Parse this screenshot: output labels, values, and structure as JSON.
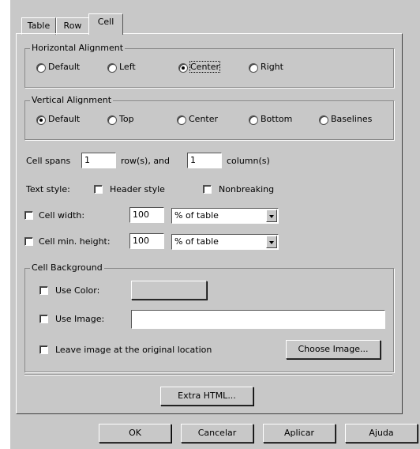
{
  "tabs": [
    "Table",
    "Row",
    "Cell"
  ],
  "horizontal": {
    "legend": "Horizontal Alignment",
    "options": [
      "Default",
      "Left",
      "Center",
      "Right"
    ],
    "selected": "Center"
  },
  "vertical": {
    "legend": "Vertical Alignment",
    "options": [
      "Default",
      "Top",
      "Center",
      "Bottom",
      "Baselines"
    ],
    "selected": "Default"
  },
  "spans": {
    "label": "Cell spans",
    "rows_value": "1",
    "rows_label": "row(s), and",
    "cols_value": "1",
    "cols_label": "column(s)"
  },
  "text_style": {
    "label": "Text style:",
    "header_label": "Header style",
    "nobreak_label": "Nonbreaking"
  },
  "width": {
    "label": "Cell width:",
    "value": "100",
    "unit": "% of table"
  },
  "height": {
    "label": "Cell min. height:",
    "value": "100",
    "unit": "% of table"
  },
  "background": {
    "legend": "Cell Background",
    "use_color": "Use Color:",
    "use_image": "Use Image:",
    "image_value": "",
    "leave_image": "Leave image at the original location",
    "choose_image": "Choose Image..."
  },
  "extra_html": "Extra HTML...",
  "footer": {
    "ok": "OK",
    "cancel": "Cancelar",
    "apply": "Aplicar",
    "help": "Ajuda"
  }
}
